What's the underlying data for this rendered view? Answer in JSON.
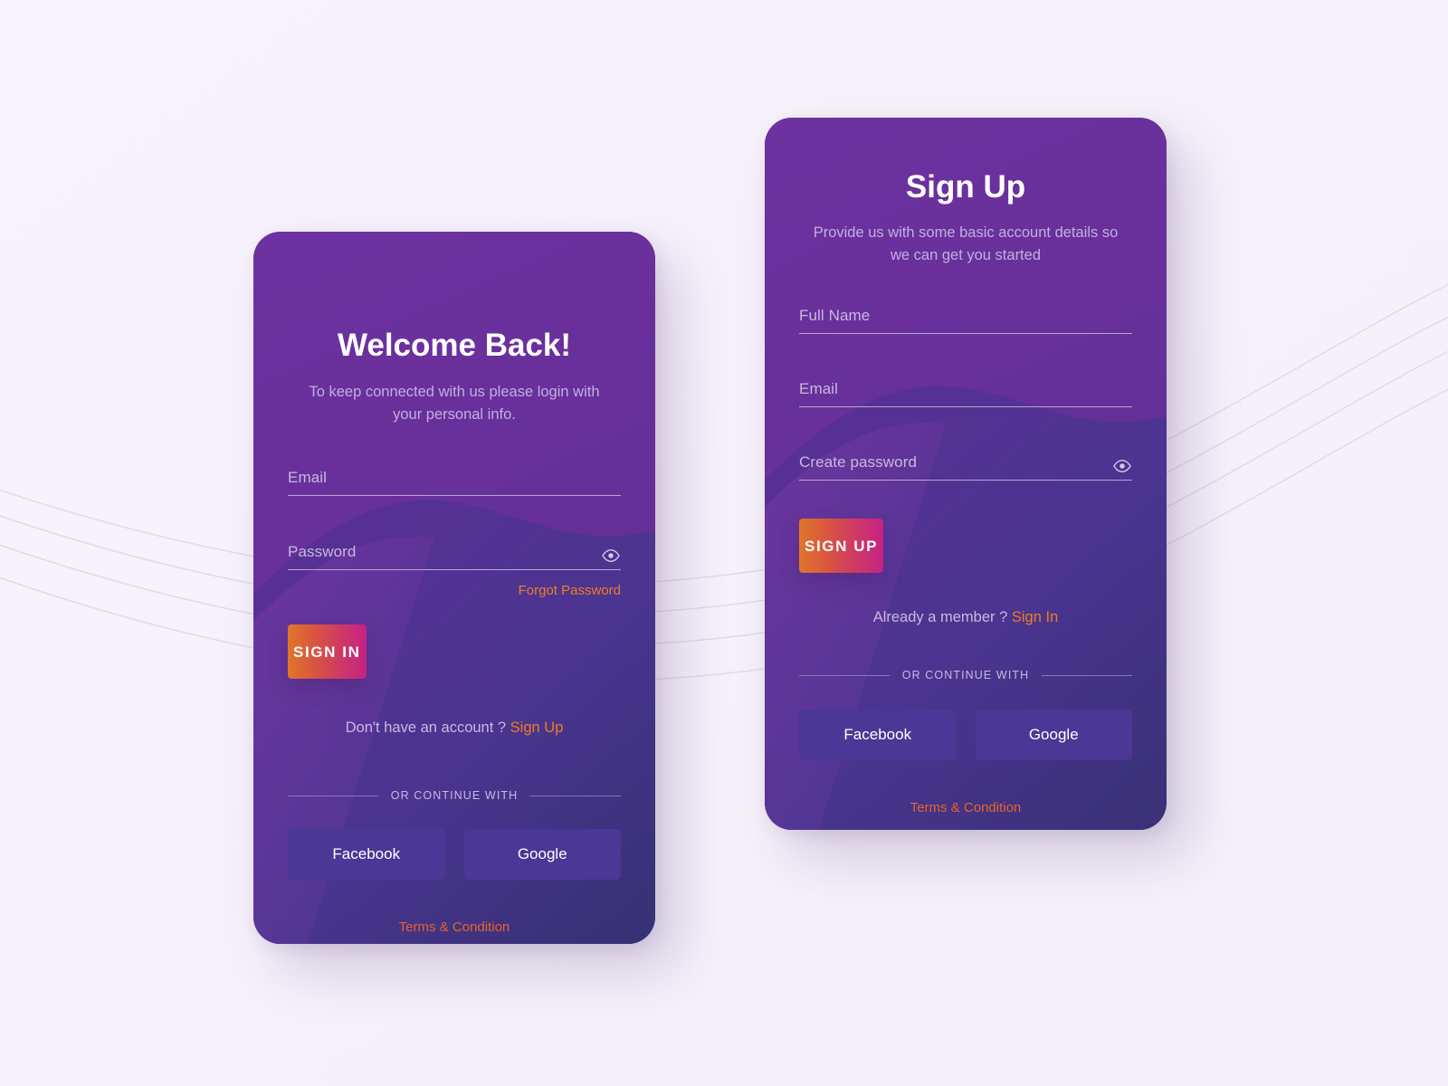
{
  "theme": {
    "page_bg": "#f7f2fb",
    "card_purple_top": "#6a3099",
    "card_purple_bottom": "#373176",
    "accent_orange": "#ef7c23",
    "accent_terms": "#e8622a",
    "cta_gradient_from": "#e0762a",
    "cta_gradient_to": "#c62283",
    "social_button_bg": "#4b3795",
    "muted_text": "#c9b8e0"
  },
  "signin": {
    "title": "Welcome Back!",
    "subtitle": "To keep connected with us please login with your personal info.",
    "fields": [
      {
        "label": "Email",
        "value": "",
        "has_eye": false
      },
      {
        "label": "Password",
        "value": "",
        "has_eye": true
      }
    ],
    "forgot_password": "Forgot Password",
    "cta_label": "SIGN IN",
    "switch_prompt": "Don't have an account ?",
    "switch_link": "Sign Up",
    "divider_label": "OR CONTINUE WITH",
    "social_buttons": [
      "Facebook",
      "Google"
    ],
    "terms": "Terms & Condition"
  },
  "signup": {
    "title": "Sign Up",
    "subtitle": "Provide us with some basic account details so we can get you started",
    "fields": [
      {
        "label": "Full Name",
        "value": "",
        "has_eye": false
      },
      {
        "label": "Email",
        "value": "",
        "has_eye": false
      },
      {
        "label": "Create password",
        "value": "",
        "has_eye": true
      }
    ],
    "cta_label": "SIGN UP",
    "switch_prompt": "Already a member ?",
    "switch_link": "Sign In",
    "divider_label": "OR CONTINUE WITH",
    "social_buttons": [
      "Facebook",
      "Google"
    ],
    "terms": "Terms & Condition"
  }
}
